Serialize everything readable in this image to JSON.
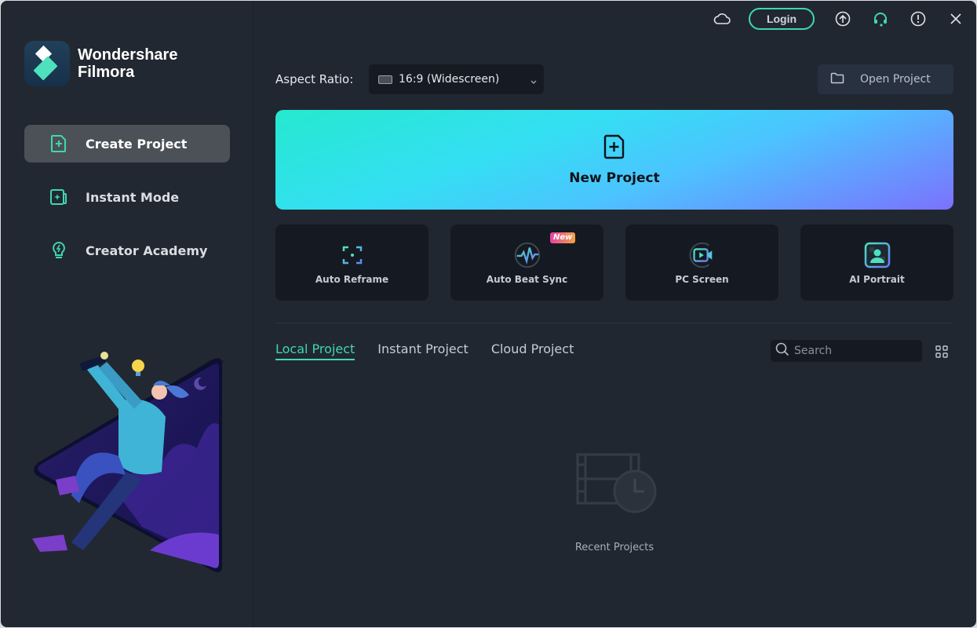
{
  "app": {
    "brand_line1": "Wondershare",
    "brand_line2": "Filmora"
  },
  "topbar": {
    "login_label": "Login"
  },
  "sidebar": {
    "items": [
      {
        "label": "Create Project",
        "icon": "file-plus-icon",
        "active": true
      },
      {
        "label": "Instant Mode",
        "icon": "instant-mode-icon",
        "active": false
      },
      {
        "label": "Creator Academy",
        "icon": "lightbulb-icon",
        "active": false
      }
    ]
  },
  "main": {
    "aspect_label": "Aspect Ratio:",
    "aspect_value": "16:9 (Widescreen)",
    "open_project_label": "Open Project",
    "new_project_label": "New Project",
    "tools": [
      {
        "label": "Auto Reframe",
        "icon": "reframe-icon",
        "badge": ""
      },
      {
        "label": "Auto Beat Sync",
        "icon": "beat-sync-icon",
        "badge": "New"
      },
      {
        "label": "PC Screen",
        "icon": "screen-record-icon",
        "badge": ""
      },
      {
        "label": "AI Portrait",
        "icon": "portrait-icon",
        "badge": ""
      }
    ],
    "tabs": [
      {
        "label": "Local Project",
        "active": true
      },
      {
        "label": "Instant Project",
        "active": false
      },
      {
        "label": "Cloud Project",
        "active": false
      }
    ],
    "search_placeholder": "Search",
    "empty_label": "Recent Projects"
  },
  "colors": {
    "accent": "#3fd7b2",
    "background": "#212731",
    "card": "#151a22"
  }
}
